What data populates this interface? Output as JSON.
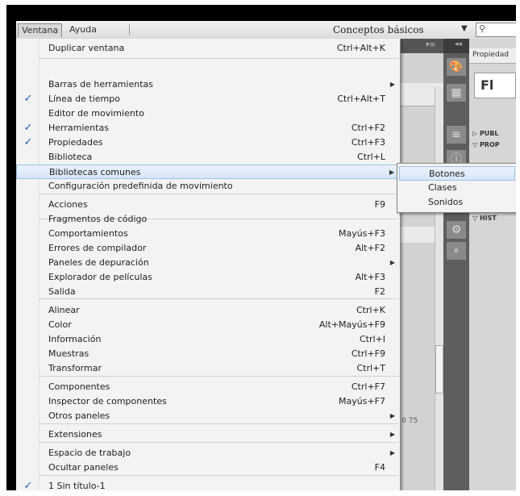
{
  "menubar": {
    "ventana": "Ventana",
    "ayuda": "Ayuda",
    "workspace": "Conceptos básicos",
    "workspace_arrow": "▼",
    "search_icon": "⚲"
  },
  "timeline": {
    "menu_icon": "▾≡",
    "ruler_num": "0      75"
  },
  "properties": {
    "tab_label": "Propiedad",
    "preview": "Fl",
    "rows": [
      "▷ PUBL",
      "▽ PROP",
      "▽ HIST"
    ]
  },
  "menu": {
    "items": [
      {
        "label": "Duplicar ventana",
        "shortcut": "Ctrl+Alt+K",
        "checked": false,
        "submenu": false
      },
      {
        "label": "Barras de herramientas",
        "shortcut": "",
        "checked": false,
        "submenu": true
      },
      {
        "label": "Línea de tiempo",
        "shortcut": "Ctrl+Alt+T",
        "checked": true,
        "submenu": false
      },
      {
        "label": "Editor de movimiento",
        "shortcut": "",
        "checked": false,
        "submenu": false
      },
      {
        "label": "Herramientas",
        "shortcut": "Ctrl+F2",
        "checked": true,
        "submenu": false
      },
      {
        "label": "Propiedades",
        "shortcut": "Ctrl+F3",
        "checked": true,
        "submenu": false
      },
      {
        "label": "Biblioteca",
        "shortcut": "Ctrl+L",
        "checked": false,
        "submenu": false
      },
      {
        "label": "Bibliotecas comunes",
        "shortcut": "",
        "checked": false,
        "submenu": true
      },
      {
        "label": "Configuración predefinida de movimiento",
        "shortcut": "",
        "checked": false,
        "submenu": false
      },
      {
        "label": "Acciones",
        "shortcut": "F9",
        "checked": false,
        "submenu": false
      },
      {
        "label": "Fragmentos de código",
        "shortcut": "",
        "checked": false,
        "submenu": false
      },
      {
        "label": "Comportamientos",
        "shortcut": "Mayús+F3",
        "checked": false,
        "submenu": false
      },
      {
        "label": "Errores de compilador",
        "shortcut": "Alt+F2",
        "checked": false,
        "submenu": false
      },
      {
        "label": "Paneles de depuración",
        "shortcut": "",
        "checked": false,
        "submenu": true
      },
      {
        "label": "Explorador de películas",
        "shortcut": "Alt+F3",
        "checked": false,
        "submenu": false
      },
      {
        "label": "Salida",
        "shortcut": "F2",
        "checked": false,
        "submenu": false
      },
      {
        "label": "Alinear",
        "shortcut": "Ctrl+K",
        "checked": false,
        "submenu": false
      },
      {
        "label": "Color",
        "shortcut": "Alt+Mayús+F9",
        "checked": false,
        "submenu": false
      },
      {
        "label": "Información",
        "shortcut": "Ctrl+I",
        "checked": false,
        "submenu": false
      },
      {
        "label": "Muestras",
        "shortcut": "Ctrl+F9",
        "checked": false,
        "submenu": false
      },
      {
        "label": "Transformar",
        "shortcut": "Ctrl+T",
        "checked": false,
        "submenu": false
      },
      {
        "label": "Componentes",
        "shortcut": "Ctrl+F7",
        "checked": false,
        "submenu": false
      },
      {
        "label": "Inspector de componentes",
        "shortcut": "Mayús+F7",
        "checked": false,
        "submenu": false
      },
      {
        "label": "Otros paneles",
        "shortcut": "",
        "checked": false,
        "submenu": true
      },
      {
        "label": "Extensiones",
        "shortcut": "",
        "checked": false,
        "submenu": true
      },
      {
        "label": "Espacio de trabajo",
        "shortcut": "",
        "checked": false,
        "submenu": true
      },
      {
        "label": "Ocultar paneles",
        "shortcut": "F4",
        "checked": false,
        "submenu": false
      },
      {
        "label": "1 Sin título-1",
        "shortcut": "",
        "checked": true,
        "submenu": false
      }
    ],
    "check_glyph": "✓",
    "arrow_glyph": "▶"
  },
  "submenu": {
    "items": [
      "Botones",
      "Clases",
      "Sonidos"
    ]
  },
  "colors": {
    "check": "#1e5bbd",
    "highlight": "#d6e6f7"
  }
}
